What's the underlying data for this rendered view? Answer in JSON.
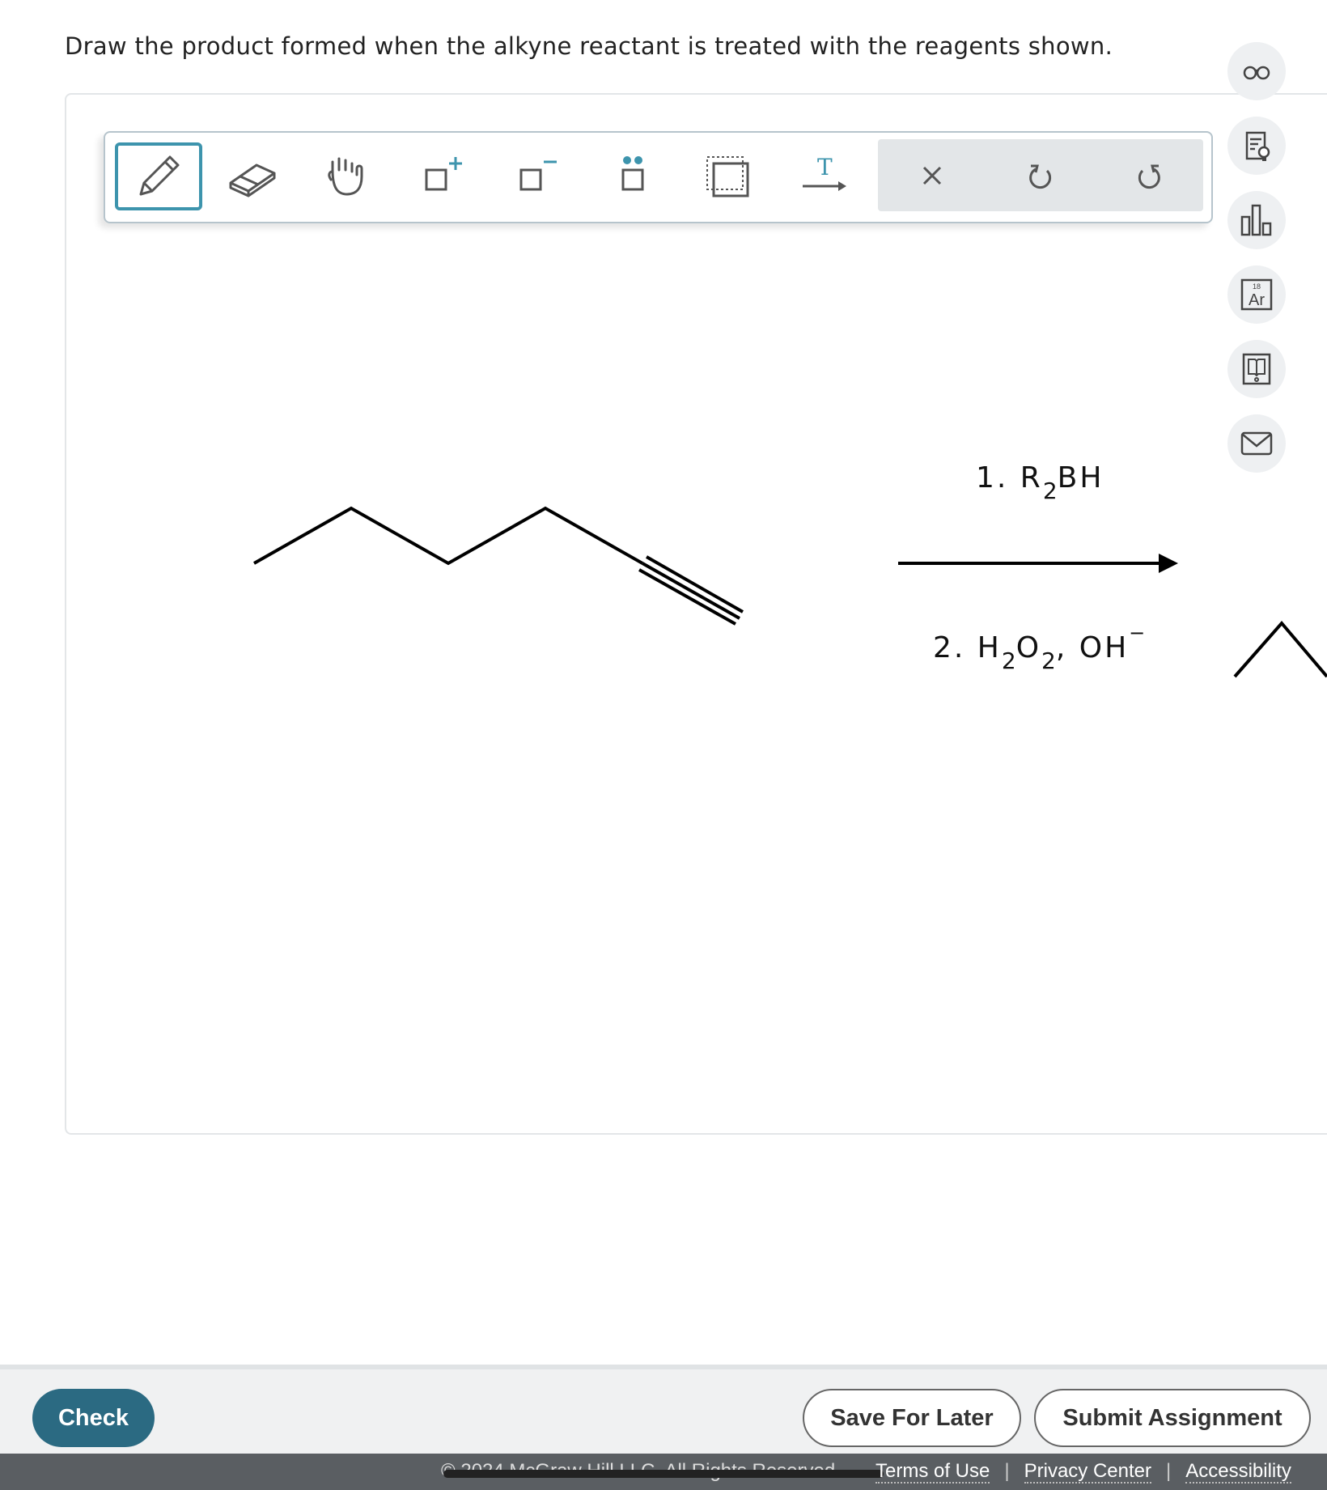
{
  "question": {
    "text": "Draw the product formed when the alkyne reactant is treated with the reagents shown."
  },
  "toolbar": {
    "tools": [
      {
        "name": "pencil-icon",
        "label": "Draw"
      },
      {
        "name": "eraser-icon",
        "label": "Erase"
      },
      {
        "name": "hand-icon",
        "label": "Move"
      },
      {
        "name": "positive-charge-icon",
        "label": "Add positive charge"
      },
      {
        "name": "negative-charge-icon",
        "label": "Add negative charge"
      },
      {
        "name": "lone-pair-icon",
        "label": "Add lone pair"
      },
      {
        "name": "select-box-icon",
        "label": "Select"
      },
      {
        "name": "text-arrow-icon",
        "label": "Text"
      }
    ],
    "text_tool_glyph": "T",
    "actions": [
      {
        "name": "clear-icon",
        "label": "Clear"
      },
      {
        "name": "undo-icon",
        "label": "Undo"
      },
      {
        "name": "redo-icon",
        "label": "Redo"
      }
    ]
  },
  "side_tools": [
    {
      "name": "glasses-icon"
    },
    {
      "name": "reference-icon"
    },
    {
      "name": "bar-chart-icon"
    },
    {
      "name": "periodic-table-icon",
      "element_number": "18",
      "element_symbol": "Ar"
    },
    {
      "name": "ebook-icon"
    },
    {
      "name": "mail-icon"
    }
  ],
  "reaction": {
    "step1": {
      "prefix": "1. R",
      "sub": "2",
      "suffix": "BH"
    },
    "step2": {
      "prefix": "2. H",
      "sub1": "2",
      "mid": "O",
      "sub2": "2",
      "tail": ", OH",
      "charge": "−"
    }
  },
  "footer": {
    "check_label": "Check",
    "save_label": "Save For Later",
    "submit_label": "Submit Assignment"
  },
  "legal": {
    "copyright": "© 2024 McGraw Hill LLC. All Rights Reserved.",
    "terms": "Terms of Use",
    "privacy": "Privacy Center",
    "accessibility": "Accessibility",
    "separator": "|"
  },
  "colors": {
    "accent": "#3d94ad",
    "check_button": "#2b6a82"
  }
}
